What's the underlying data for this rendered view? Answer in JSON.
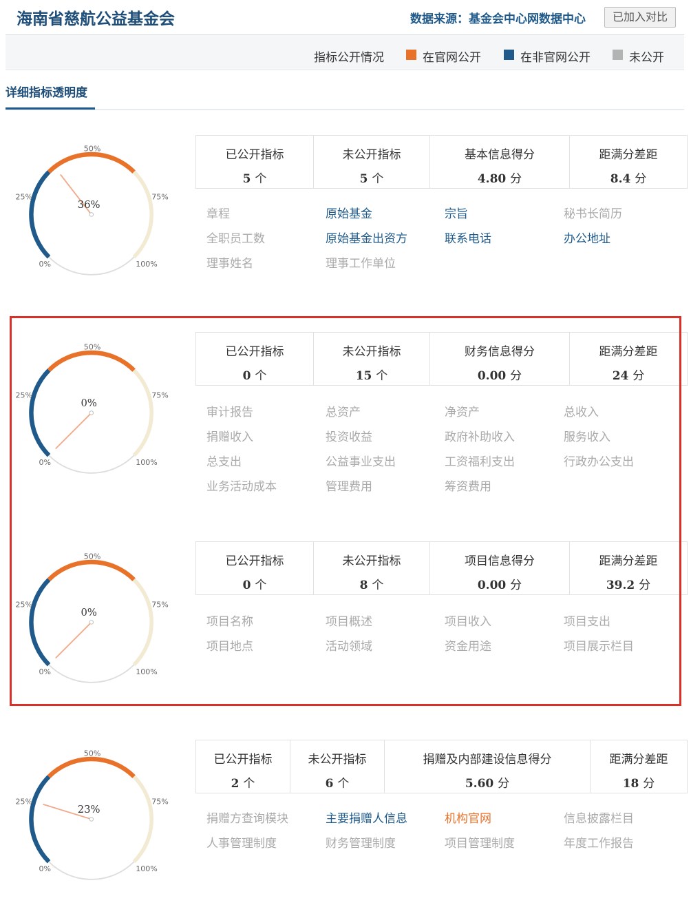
{
  "header": {
    "org_title": "海南省慈航公益基金会",
    "source_label": "数据来源：基金会中心网数据中心",
    "compare_button": "已加入对比"
  },
  "legend": {
    "title": "指标公开情况",
    "items": [
      {
        "label": "在官网公开",
        "color": "#e8722a"
      },
      {
        "label": "在非官网公开",
        "color": "#1f5a8a"
      },
      {
        "label": "未公开",
        "color": "#b3b3b3"
      }
    ]
  },
  "section_tab": "详细指标透明度",
  "gauge_ticks": [
    "0%",
    "25%",
    "50%",
    "75%",
    "100%"
  ],
  "colors": {
    "official": "#1f5a8a",
    "nonofficial": "#e8722a",
    "unpublished": "#aaaaaa",
    "gauge_blue": "#1f5a8a",
    "gauge_orange": "#e8722a",
    "gauge_cream": "#f3ead3",
    "gauge_gray": "#dddddd",
    "needle": "#f0a98a",
    "highlight": "#d9302a"
  },
  "sections": [
    {
      "gauge_value": "36%",
      "gauge_fraction": 0.36,
      "stats": [
        {
          "label": "已公开指标",
          "value": "5",
          "unit": "个"
        },
        {
          "label": "未公开指标",
          "value": "5",
          "unit": "个"
        },
        {
          "label": "基本信息得分",
          "value": "4.80",
          "unit": "分"
        },
        {
          "label": "距满分差距",
          "value": "8.4",
          "unit": "分"
        }
      ],
      "indicators": [
        {
          "label": "章程",
          "status": "unpublished"
        },
        {
          "label": "原始基金",
          "status": "official"
        },
        {
          "label": "宗旨",
          "status": "official"
        },
        {
          "label": "秘书长简历",
          "status": "unpublished"
        },
        {
          "label": "全职员工数",
          "status": "unpublished"
        },
        {
          "label": "原始基金出资方",
          "status": "official"
        },
        {
          "label": "联系电话",
          "status": "official"
        },
        {
          "label": "办公地址",
          "status": "official"
        },
        {
          "label": "理事姓名",
          "status": "unpublished"
        },
        {
          "label": "理事工作单位",
          "status": "unpublished"
        }
      ]
    },
    {
      "gauge_value": "0%",
      "gauge_fraction": 0,
      "stats": [
        {
          "label": "已公开指标",
          "value": "0",
          "unit": "个"
        },
        {
          "label": "未公开指标",
          "value": "15",
          "unit": "个"
        },
        {
          "label": "财务信息得分",
          "value": "0.00",
          "unit": "分"
        },
        {
          "label": "距满分差距",
          "value": "24",
          "unit": "分"
        }
      ],
      "indicators": [
        {
          "label": "审计报告",
          "status": "unpublished"
        },
        {
          "label": "总资产",
          "status": "unpublished"
        },
        {
          "label": "净资产",
          "status": "unpublished"
        },
        {
          "label": "总收入",
          "status": "unpublished"
        },
        {
          "label": "捐赠收入",
          "status": "unpublished"
        },
        {
          "label": "投资收益",
          "status": "unpublished"
        },
        {
          "label": "政府补助收入",
          "status": "unpublished"
        },
        {
          "label": "服务收入",
          "status": "unpublished"
        },
        {
          "label": "总支出",
          "status": "unpublished"
        },
        {
          "label": "公益事业支出",
          "status": "unpublished"
        },
        {
          "label": "工资福利支出",
          "status": "unpublished"
        },
        {
          "label": "行政办公支出",
          "status": "unpublished"
        },
        {
          "label": "业务活动成本",
          "status": "unpublished"
        },
        {
          "label": "管理费用",
          "status": "unpublished"
        },
        {
          "label": "筹资费用",
          "status": "unpublished"
        }
      ]
    },
    {
      "gauge_value": "0%",
      "gauge_fraction": 0,
      "stats": [
        {
          "label": "已公开指标",
          "value": "0",
          "unit": "个"
        },
        {
          "label": "未公开指标",
          "value": "8",
          "unit": "个"
        },
        {
          "label": "项目信息得分",
          "value": "0.00",
          "unit": "分"
        },
        {
          "label": "距满分差距",
          "value": "39.2",
          "unit": "分"
        }
      ],
      "indicators": [
        {
          "label": "项目名称",
          "status": "unpublished"
        },
        {
          "label": "项目概述",
          "status": "unpublished"
        },
        {
          "label": "项目收入",
          "status": "unpublished"
        },
        {
          "label": "项目支出",
          "status": "unpublished"
        },
        {
          "label": "项目地点",
          "status": "unpublished"
        },
        {
          "label": "活动领域",
          "status": "unpublished"
        },
        {
          "label": "资金用途",
          "status": "unpublished"
        },
        {
          "label": "项目展示栏目",
          "status": "unpublished"
        }
      ]
    },
    {
      "gauge_value": "23%",
      "gauge_fraction": 0.23,
      "stats": [
        {
          "label": "已公开指标",
          "value": "2",
          "unit": "个"
        },
        {
          "label": "未公开指标",
          "value": "6",
          "unit": "个"
        },
        {
          "label": "捐赠及内部建设信息得分",
          "value": "5.60",
          "unit": "分"
        },
        {
          "label": "距满分差距",
          "value": "18",
          "unit": "分"
        }
      ],
      "indicators": [
        {
          "label": "捐赠方查询模块",
          "status": "unpublished"
        },
        {
          "label": "主要捐赠人信息",
          "status": "official"
        },
        {
          "label": "机构官网",
          "status": "nonofficial"
        },
        {
          "label": "信息披露栏目",
          "status": "unpublished"
        },
        {
          "label": "人事管理制度",
          "status": "unpublished"
        },
        {
          "label": "财务管理制度",
          "status": "unpublished"
        },
        {
          "label": "项目管理制度",
          "status": "unpublished"
        },
        {
          "label": "年度工作报告",
          "status": "unpublished"
        }
      ]
    }
  ]
}
